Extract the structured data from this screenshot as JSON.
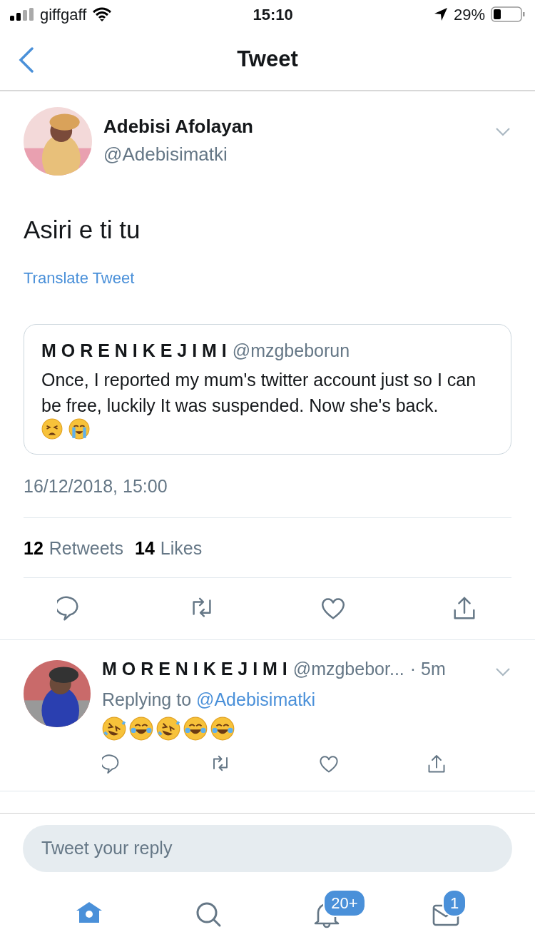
{
  "status_bar": {
    "carrier": "giffgaff",
    "time": "15:10",
    "battery": "29%"
  },
  "nav": {
    "title": "Tweet"
  },
  "tweet": {
    "name": "Adebisi Afolayan",
    "handle": "@Adebisimatki",
    "text": "Asiri e ti tu",
    "translate": "Translate Tweet",
    "quote": {
      "name": "M O R E N I K E J I M I",
      "handle": "@mzgbeborun",
      "text": "Once, I reported my mum's twitter account just so I can be free, luckily It was suspended. Now she's back.",
      "emojis": [
        {
          "kind": "tired"
        },
        {
          "kind": "crying"
        }
      ]
    },
    "date": "16/12/2018, 15:00",
    "retweets_count": "12",
    "retweets_label": "Retweets",
    "likes_count": "14",
    "likes_label": "Likes"
  },
  "replies": [
    {
      "name": "M O R E N I K E J I M I",
      "handle": "@mzgbebor...",
      "time": "· 5m",
      "replying_label": "Replying to",
      "replying_to": "@Adebisimatki",
      "emojis": [
        {
          "kind": "rofl"
        },
        {
          "kind": "joy"
        },
        {
          "kind": "rofl"
        },
        {
          "kind": "joy"
        },
        {
          "kind": "joy"
        }
      ]
    }
  ],
  "reply_field": {
    "placeholder": "Tweet your reply"
  },
  "tab_bar": [
    {
      "kind": "home",
      "selected": true
    },
    {
      "kind": "search",
      "selected": false
    },
    {
      "kind": "notifications",
      "selected": false,
      "badge": "20+"
    },
    {
      "kind": "messages",
      "selected": false,
      "badge": "1"
    }
  ]
}
